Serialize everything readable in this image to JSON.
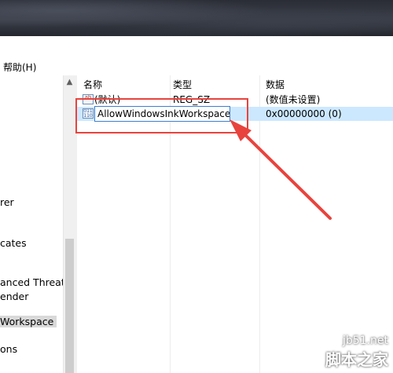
{
  "menubar": {
    "help_label": "帮助(H)"
  },
  "tree": {
    "items": [
      {
        "label": "rer"
      },
      {
        "label": "cates"
      },
      {
        "label": "anced Threat P"
      },
      {
        "label": "ender"
      },
      {
        "label": "Workspace"
      },
      {
        "label": "ons"
      }
    ],
    "scroll_up_icon": "chevron-up-icon"
  },
  "list": {
    "columns": [
      "名称",
      "类型",
      "数据"
    ],
    "rows": [
      {
        "name": "(默认)",
        "type": "REG_SZ",
        "data": "(数值未设置)",
        "icon": "string-value-icon"
      },
      {
        "name": "AllowWindowsInkWorkspace",
        "type": "",
        "data": "0x00000000 (0)",
        "icon": "dword-value-icon"
      }
    ]
  },
  "annotation": {
    "color": "#e8433d"
  },
  "watermark": {
    "site": "jb51.net",
    "brand": "脚本之家"
  }
}
